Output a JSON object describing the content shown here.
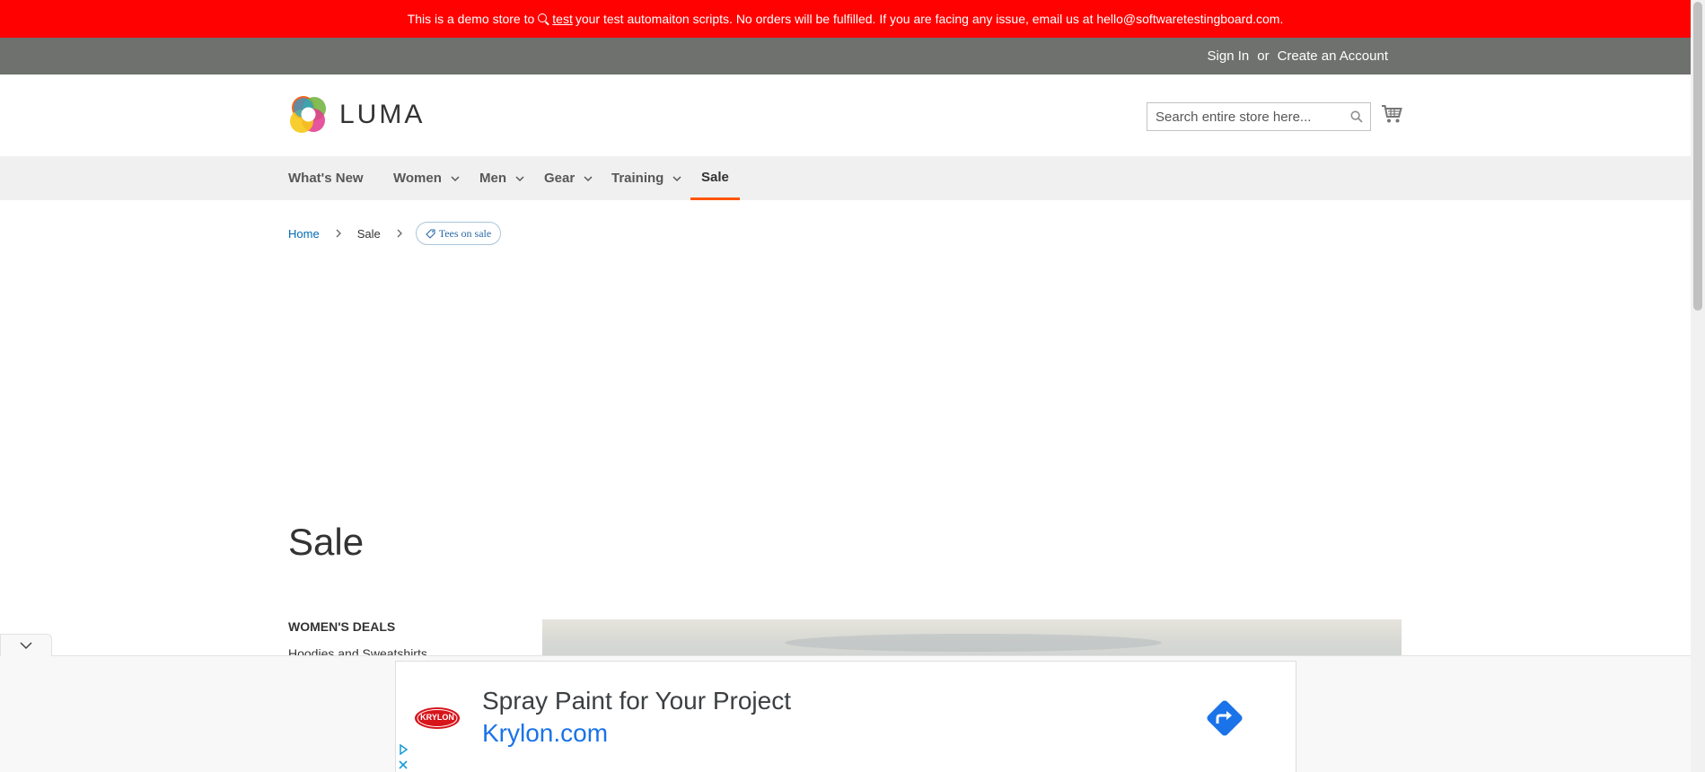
{
  "demo_notice": {
    "prefix": "This is a demo store to",
    "link": "test",
    "suffix": "your test automaiton scripts. No orders will be fulfilled. If you are facing any issue, email us at hello@softwaretestingboard.com."
  },
  "panel": {
    "sign_in": "Sign In",
    "or": "or",
    "create_account": "Create an Account"
  },
  "header": {
    "logo_text": "LUMA",
    "search_placeholder": "Search entire store here...",
    "search_value": ""
  },
  "nav": {
    "items": [
      {
        "label": "What's New",
        "has_submenu": false
      },
      {
        "label": "Women",
        "has_submenu": true
      },
      {
        "label": "Men",
        "has_submenu": true
      },
      {
        "label": "Gear",
        "has_submenu": true
      },
      {
        "label": "Training",
        "has_submenu": true
      },
      {
        "label": "Sale",
        "has_submenu": false,
        "active": true
      }
    ]
  },
  "breadcrumbs": {
    "home": "Home",
    "current": "Sale",
    "chip": "Tees on sale"
  },
  "page": {
    "title": "Sale"
  },
  "sidebar": {
    "section_title": "WOMEN'S DEALS",
    "links": [
      "Hoodies and Sweatshirts"
    ]
  },
  "ad": {
    "brand": "KRYLON",
    "headline": "Spray Paint for Your Project",
    "domain": "Krylon.com"
  },
  "colors": {
    "notice_red": "#ff0101",
    "panel_gray": "#6e716e",
    "nav_bg": "#f0f0f0",
    "nav_active": "#ff5501",
    "link_blue": "#006bb4",
    "ad_blue": "#1a73e8"
  }
}
